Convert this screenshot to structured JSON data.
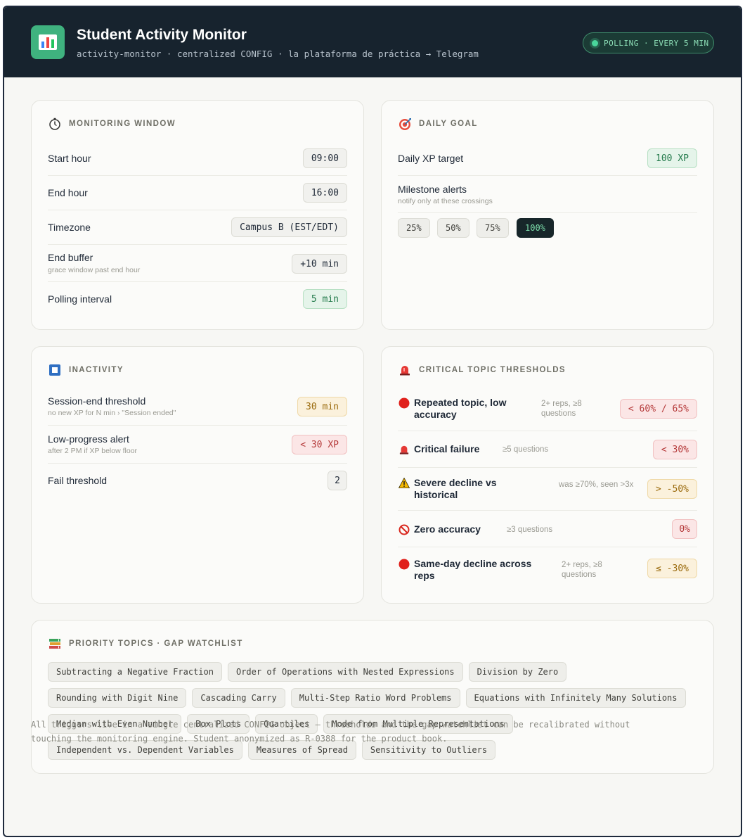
{
  "header": {
    "title": "Student Activity Monitor",
    "subtitle": "activity-monitor · centralized CONFIG · la plataforma de práctica → Telegram",
    "status": "POLLING · EVERY 5 MIN",
    "icon": "bar-chart-icon"
  },
  "monitoring": {
    "title": "MONITORING WINDOW",
    "icon": "stopwatch-icon",
    "rows": [
      {
        "label": "Start hour",
        "hint": "",
        "value": "09:00"
      },
      {
        "label": "End hour",
        "hint": "",
        "value": "16:00"
      },
      {
        "label": "Timezone",
        "hint": "",
        "value": "Campus B (EST/EDT)"
      },
      {
        "label": "End buffer",
        "hint": "grace window past end hour",
        "value": "+10 min"
      },
      {
        "label": "Polling interval",
        "hint": "",
        "value": "5 min"
      }
    ]
  },
  "daily_goal": {
    "title": "DAILY GOAL",
    "icon": "target-icon",
    "target_label": "Daily XP target",
    "target_value": "100 XP",
    "milestone_label": "Milestone alerts",
    "milestone_hint": "notify only at these crossings",
    "milestones": [
      "25%",
      "50%",
      "75%",
      "100%"
    ],
    "active_milestone": "100%"
  },
  "inactivity": {
    "title": "INACTIVITY",
    "icon": "stop-square-icon",
    "rows": [
      {
        "label": "Session-end threshold",
        "hint": "no new XP for N min   › \"Session ended\"",
        "value": "30 min"
      },
      {
        "label": "Low-progress alert",
        "hint": "after 2 PM if XP below floor",
        "value": "< 30 XP"
      },
      {
        "label": "Fail threshold",
        "hint": "",
        "value": "2"
      }
    ]
  },
  "critical": {
    "title": "CRITICAL TOPIC THRESHOLDS",
    "icon": "siren-icon",
    "rows": [
      {
        "icon": "red-circle-icon",
        "label": "Repeated topic, low accuracy",
        "hint": "2+ reps, ≥8 questions",
        "value": "< 60% / 65%"
      },
      {
        "icon": "siren-icon",
        "label": "Critical failure",
        "hint": "≥5 questions",
        "value": "< 30%"
      },
      {
        "icon": "warning-icon",
        "label": "Severe decline vs historical",
        "hint": "was ≥70%, seen >3x",
        "value": "> -50%"
      },
      {
        "icon": "prohibited-icon",
        "label": "Zero accuracy",
        "hint": "≥3 questions",
        "value": "0%"
      },
      {
        "icon": "red-circle-icon",
        "label": "Same-day decline across reps",
        "hint": "2+ reps, ≥8 questions",
        "value": "≤ -30%"
      }
    ]
  },
  "priority": {
    "title": "PRIORITY TOPICS · GAP WATCHLIST",
    "icon": "books-icon",
    "topics": [
      "Subtracting a Negative Fraction",
      "Order of Operations with Nested Expressions",
      "Division by Zero",
      "Rounding with Digit Nine",
      "Cascading Carry",
      "Multi-Step Ratio Word Problems",
      "Equations with Infinitely Many Solutions",
      "Median with Even Number",
      "Box Plots",
      "Quartiles",
      "Mode from Multiple Representations",
      "Independent vs. Dependent Variables",
      "Measures of Spread",
      "Sensitivity to Outliers"
    ]
  },
  "footnote": "All triggers live in a single centralized CONFIG object — thresholds and the gap watchlist can be recalibrated without touching the monitoring engine. Student anonymized as R-0388 for the product book."
}
